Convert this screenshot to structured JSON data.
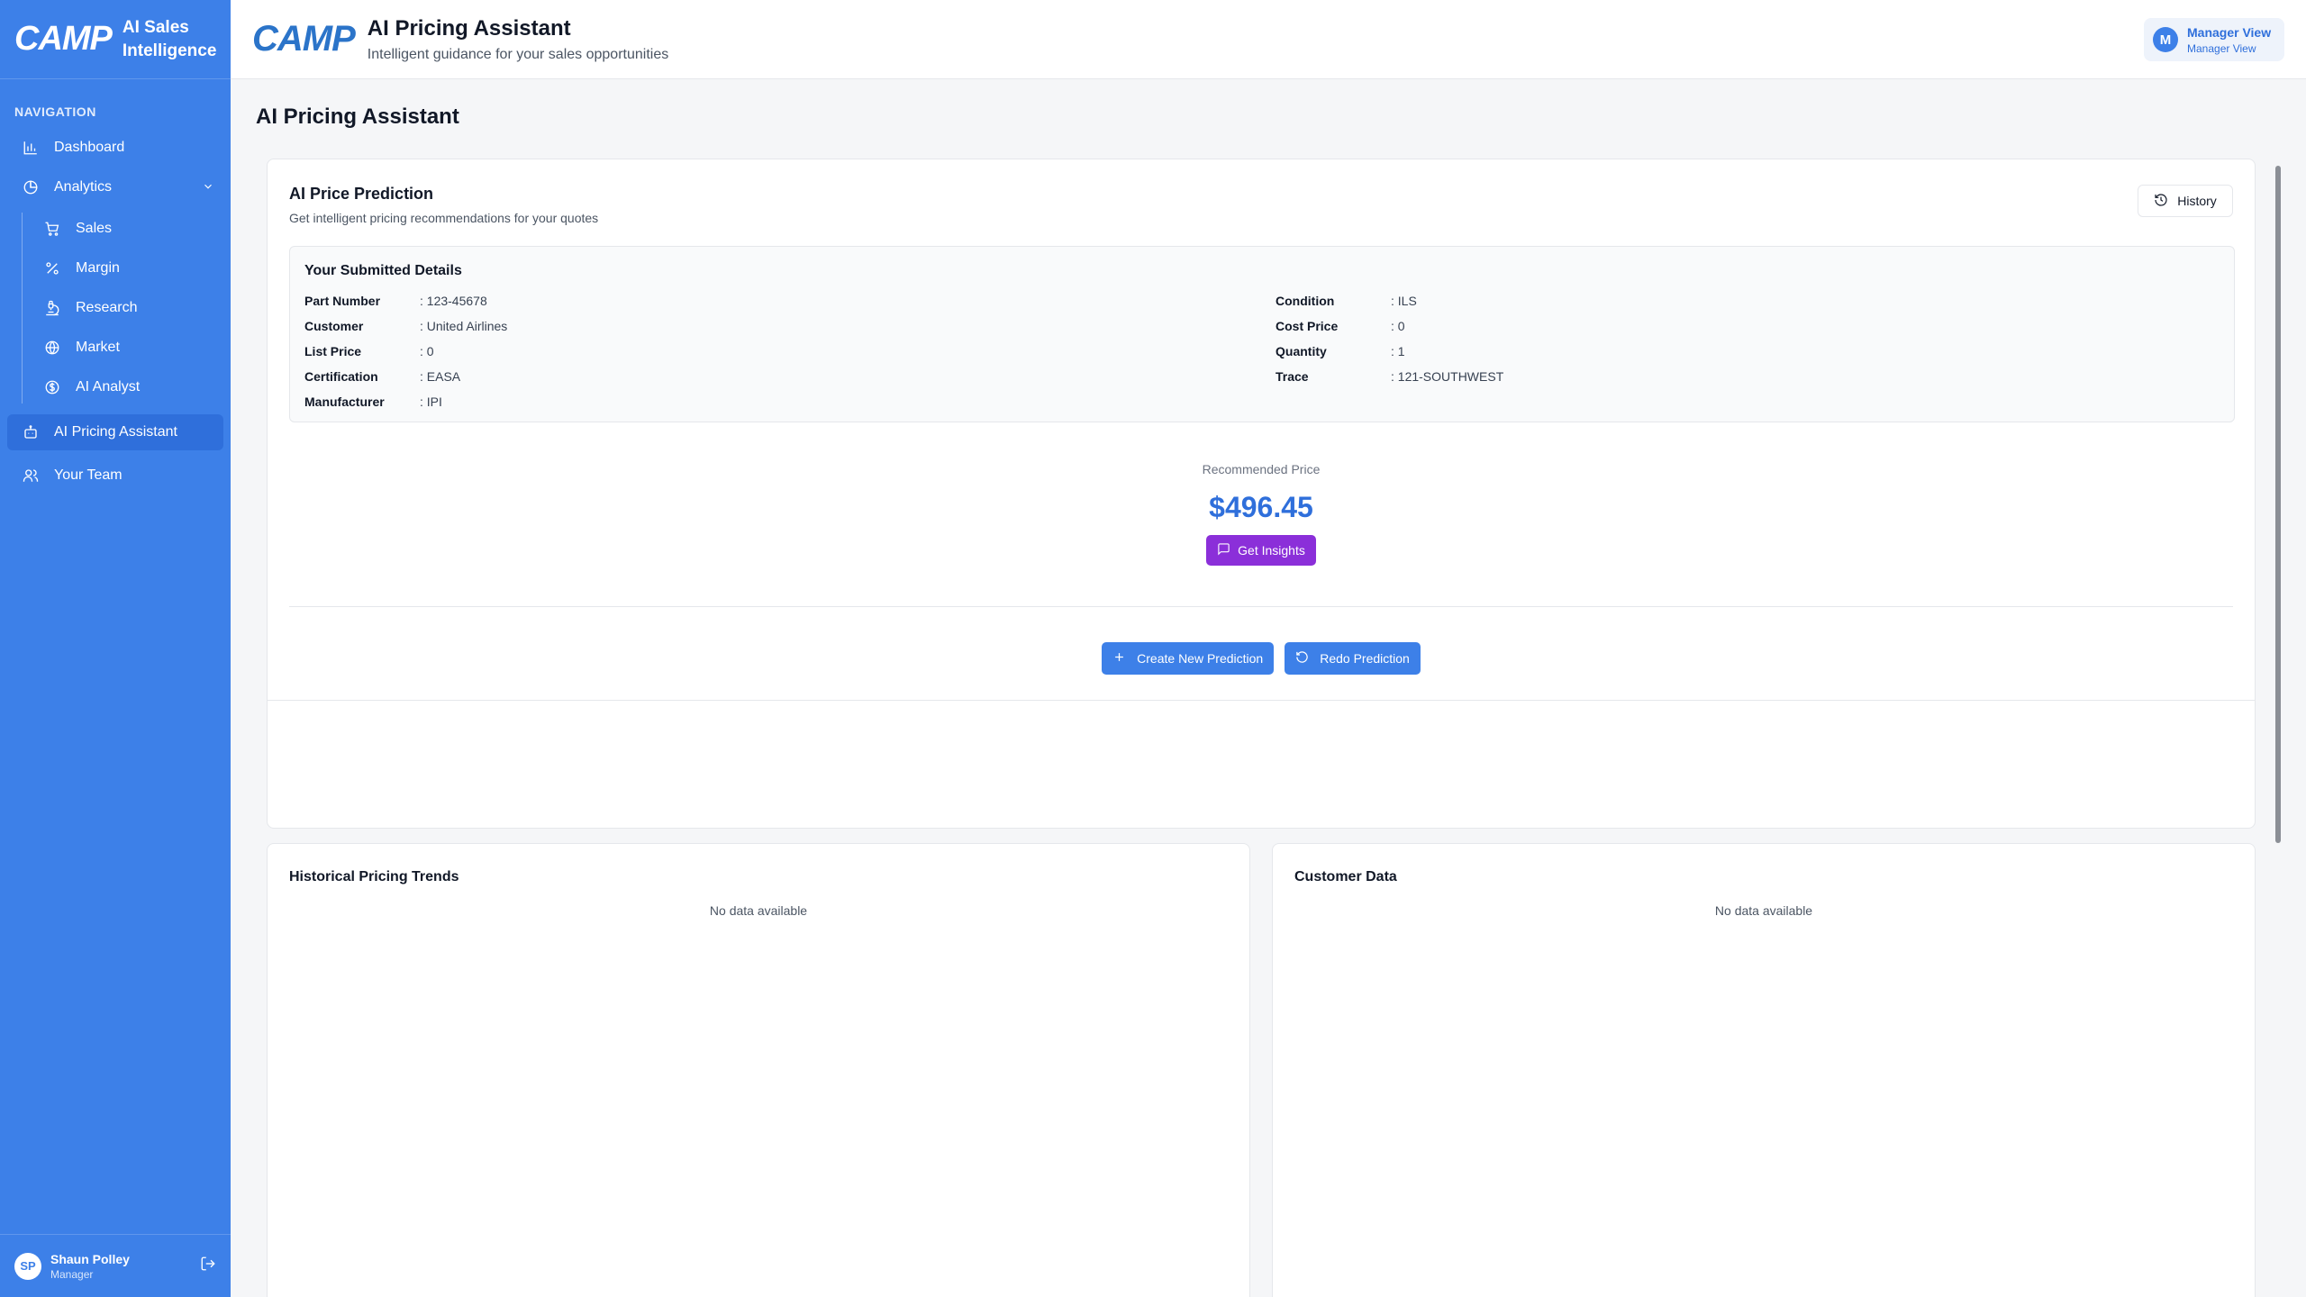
{
  "sidebar": {
    "logo": "CAMP",
    "title": "AI Sales Intelligence",
    "nav_heading": "NAVIGATION",
    "items": {
      "dashboard": "Dashboard",
      "analytics": "Analytics",
      "sales": "Sales",
      "margin": "Margin",
      "research": "Research",
      "market": "Market",
      "ai_analyst": "AI Analyst",
      "ai_pricing": "AI Pricing Assistant",
      "team": "Your Team"
    },
    "user": {
      "initials": "SP",
      "name": "Shaun Polley",
      "role": "Manager"
    }
  },
  "header": {
    "logo": "CAMP",
    "title": "AI Pricing Assistant",
    "subtitle": "Intelligent guidance for your sales opportunities",
    "view": {
      "initial": "M",
      "line1": "Manager View",
      "line2": "Manager View"
    }
  },
  "main": {
    "page_title": "AI Pricing Assistant",
    "prediction": {
      "title": "AI Price Prediction",
      "subtitle": "Get intelligent pricing recommendations for your quotes",
      "history_label": "History",
      "details_title": "Your Submitted Details",
      "left": [
        {
          "k": "Part Number",
          "v": ": 123-45678"
        },
        {
          "k": "Customer",
          "v": ": United Airlines"
        },
        {
          "k": "List Price",
          "v": ": 0"
        },
        {
          "k": "Certification",
          "v": ": EASA"
        },
        {
          "k": "Manufacturer",
          "v": ": IPI"
        }
      ],
      "right": [
        {
          "k": "Condition",
          "v": ": ILS"
        },
        {
          "k": "Cost Price",
          "v": ": 0"
        },
        {
          "k": "Quantity",
          "v": ": 1"
        },
        {
          "k": "Trace",
          "v": ": 121-SOUTHWEST"
        }
      ],
      "recommended_label": "Recommended Price",
      "recommended_price": "$496.45",
      "insights_label": "Get Insights",
      "create_label": "Create New Prediction",
      "redo_label": "Redo Prediction"
    },
    "historical": {
      "title": "Historical Pricing Trends",
      "empty": "No data available"
    },
    "customer": {
      "title": "Customer Data",
      "empty": "No data available"
    }
  }
}
